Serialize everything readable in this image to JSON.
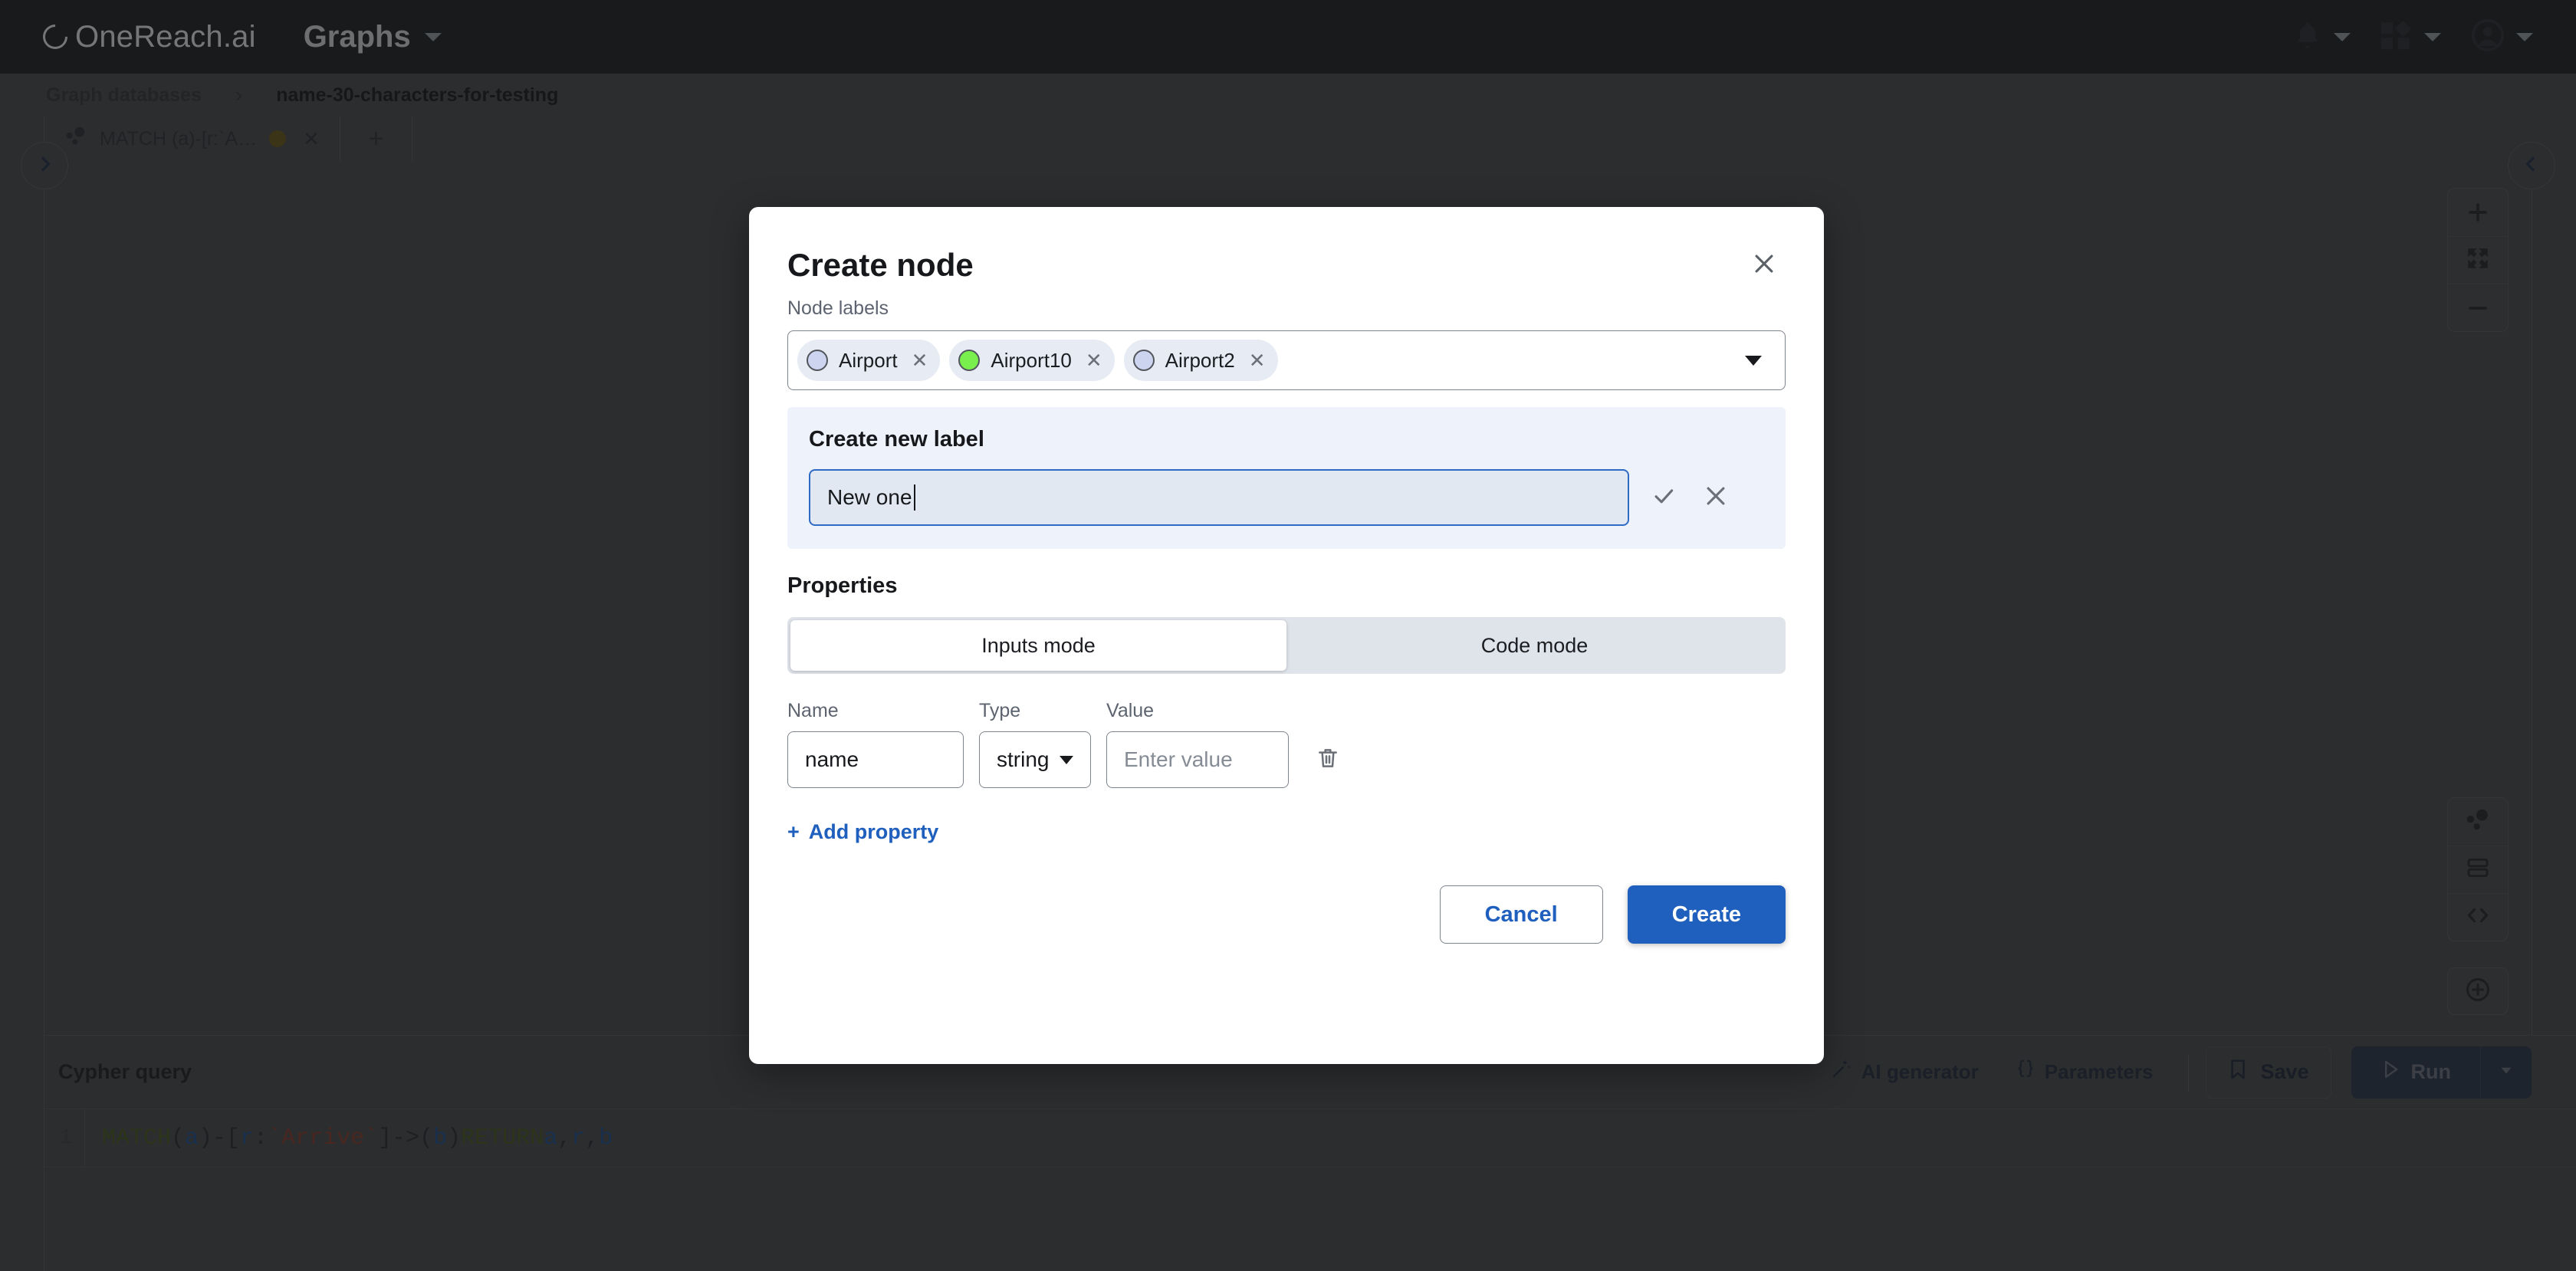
{
  "topbar": {
    "brand": "OneReach.ai",
    "app_name": "Graphs",
    "icons": {
      "notifications": "bell-icon",
      "apps": "apps-grid-icon",
      "account": "user-avatar-icon"
    }
  },
  "breadcrumb": {
    "root": "Graph databases",
    "separator": "›",
    "current": "name-30-characters-for-testing"
  },
  "tabs": {
    "items": [
      {
        "label": "MATCH (a)-[r:`A…",
        "status_color": "#6d5a18",
        "close": "✕"
      }
    ],
    "add_label": "+"
  },
  "rails": {
    "left_toggle": "chevron-right",
    "right_toggle": "chevron-left",
    "zoom_in": "+",
    "fit_screen": "fit-screen-icon",
    "zoom_out": "–",
    "view_graph": "graph-view-icon",
    "view_table": "table-view-icon",
    "view_code": "code-view-icon",
    "add_node": "add-node-icon"
  },
  "query": {
    "title": "Cypher query",
    "ai_generator": "AI generator",
    "parameters": "Parameters",
    "save": "Save",
    "run": "Run",
    "line_number": "1",
    "tokens": [
      {
        "t": "MATCH ",
        "k": "kw"
      },
      {
        "t": "(",
        "k": "punc"
      },
      {
        "t": "a",
        "k": "var"
      },
      {
        "t": ")-[",
        "k": "punc"
      },
      {
        "t": "r",
        "k": "var"
      },
      {
        "t": ":",
        "k": "punc"
      },
      {
        "t": "`Arrive`",
        "k": "str"
      },
      {
        "t": "]->(",
        "k": "punc"
      },
      {
        "t": "b",
        "k": "var"
      },
      {
        "t": ") ",
        "k": "punc"
      },
      {
        "t": "RETURN ",
        "k": "kw"
      },
      {
        "t": "a",
        "k": "var"
      },
      {
        "t": ", ",
        "k": "punc"
      },
      {
        "t": "r",
        "k": "var"
      },
      {
        "t": ", ",
        "k": "punc"
      },
      {
        "t": "b",
        "k": "var"
      }
    ],
    "full_text": "MATCH (a)-[r:`Arrive`]->(b) RETURN a, r, b"
  },
  "modal": {
    "title": "Create node",
    "close": "✕",
    "node_labels_label": "Node labels",
    "chips": [
      {
        "name": "Airport",
        "color": "#ccd4ef",
        "remove": "✕"
      },
      {
        "name": "Airport10",
        "color": "#79ef4e",
        "remove": "✕"
      },
      {
        "name": "Airport2",
        "color": "#ccd4ef",
        "remove": "✕"
      }
    ],
    "new_label": {
      "heading": "Create new label",
      "value": "New one",
      "placeholder": "",
      "confirm": "✓",
      "cancel": "✕"
    },
    "properties": {
      "heading": "Properties",
      "modes": [
        {
          "label": "Inputs mode",
          "active": true
        },
        {
          "label": "Code mode",
          "active": false
        }
      ],
      "columns": {
        "name": "Name",
        "type": "Type",
        "value": "Value"
      },
      "rows": [
        {
          "name": "name",
          "type": "string",
          "value": "",
          "value_placeholder": "Enter value",
          "delete": "trash-icon"
        }
      ],
      "add_property": "Add property",
      "add_property_sign": "+"
    },
    "cancel": "Cancel",
    "create": "Create"
  },
  "colors": {
    "accent": "#1f5fbd",
    "topbar_bg": "#1e2023",
    "canvas_bg": "#4a4b4d",
    "panel_bg": "#eef2fa"
  }
}
